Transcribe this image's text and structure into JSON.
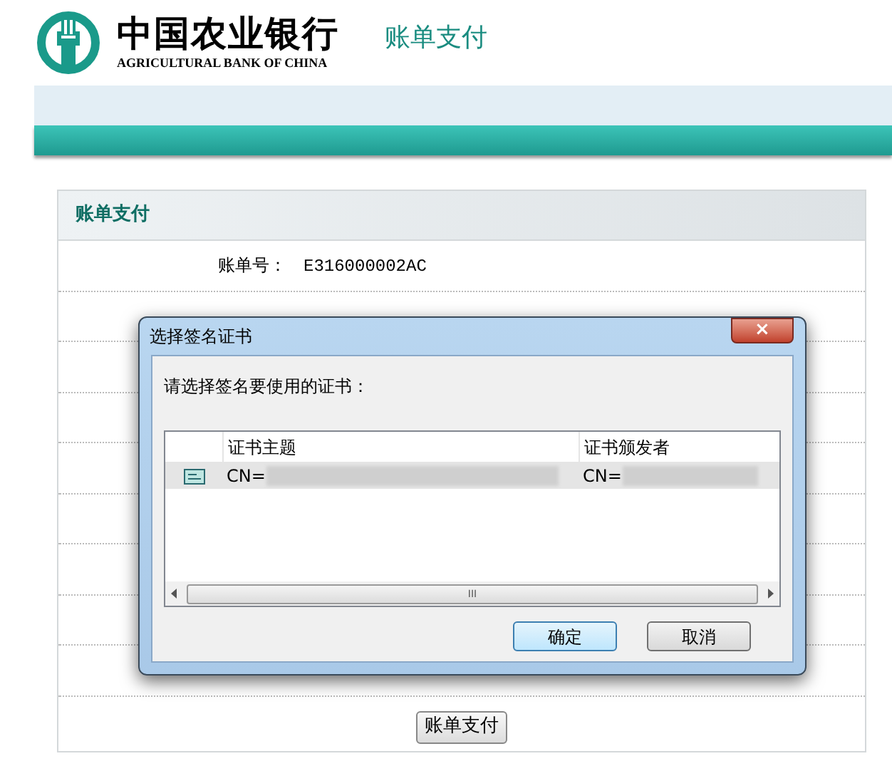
{
  "header": {
    "bank_name": "中国农业银行",
    "bank_name_en": "AGRICULTURAL BANK OF CHINA",
    "page_title": "账单支付"
  },
  "panel": {
    "title": "账单支付",
    "rows": [
      {
        "label": "账单号：",
        "value": "E316000002AC"
      }
    ],
    "submit_button": "账单支付"
  },
  "dialog": {
    "title": "选择签名证书",
    "close": "×",
    "prompt": "请选择签名要使用的证书：",
    "columns": [
      "证书主题",
      "证书颁发者"
    ],
    "rows": [
      {
        "subject": "CN=",
        "issuer": "CN=",
        "selected": true
      }
    ],
    "scroll_grip": "III",
    "buttons": [
      {
        "label": "确定",
        "kind": "default"
      },
      {
        "label": "取消",
        "kind": "normal"
      }
    ]
  }
}
